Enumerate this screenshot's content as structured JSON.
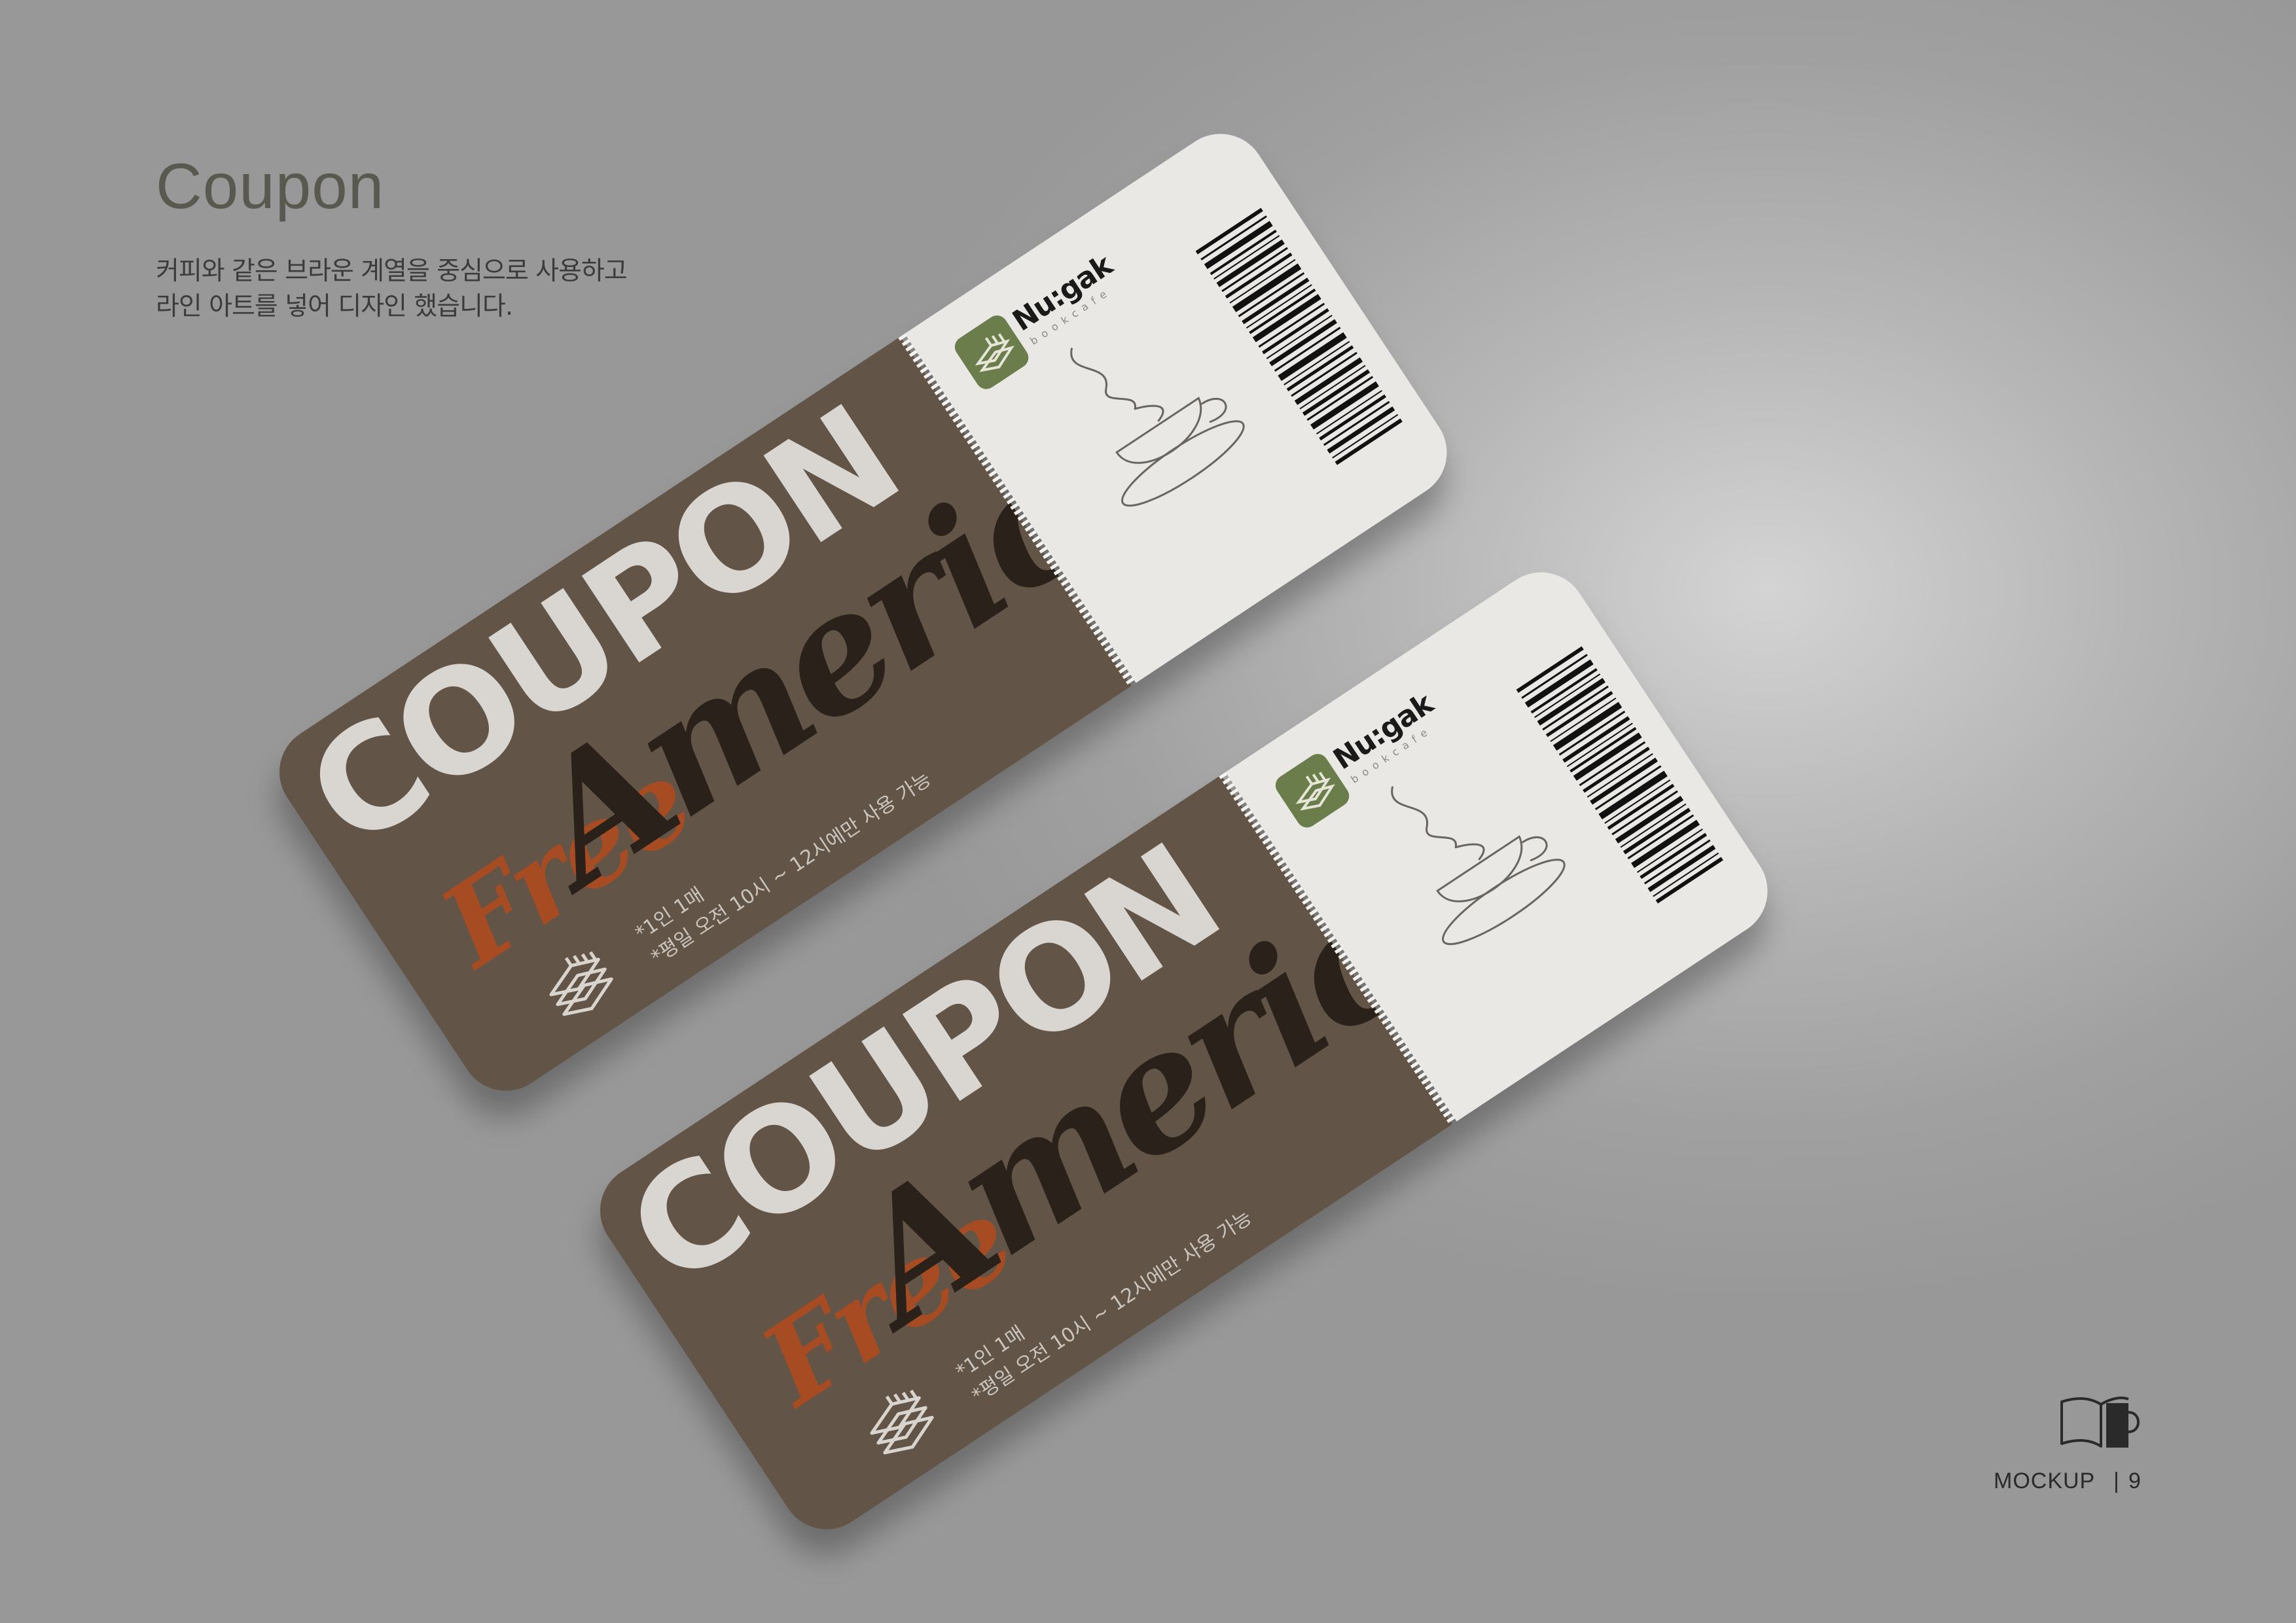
{
  "page": {
    "title": "Coupon",
    "description_line1": "커피와 같은 브라운 계열을 중심으로 사용하고",
    "description_line2": "라인 아트를 넣어 디자인 했습니다."
  },
  "coupon": {
    "headline": "COUPON",
    "free": "Free",
    "product": "Americano",
    "note_1": "*1인 1매",
    "note_2": "*평일 오전 10시 ~ 12시에만 사용 가능",
    "logo_name": "Nu:gak",
    "logo_sub": "bookcafe"
  },
  "footer": {
    "section": "MOCKUP",
    "separator": "|",
    "page_number": "9",
    "icon": "open-book-mug-icon"
  },
  "colors": {
    "background": "#a6a6a6",
    "coupon_body": "#625446",
    "coupon_stub": "#e9e8e4",
    "free_text": "#a74c22",
    "americano_text": "#2a211a",
    "logo_green": "#6b7d4a"
  }
}
